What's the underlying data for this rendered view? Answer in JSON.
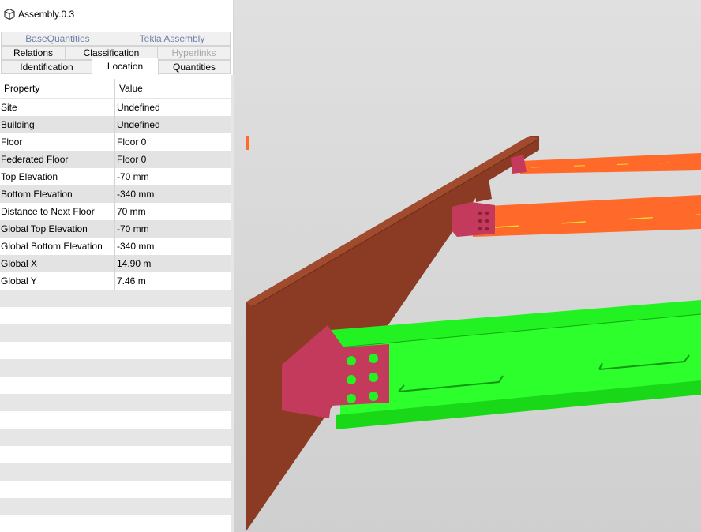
{
  "window": {
    "title": "Assembly.0.3"
  },
  "tabs": [
    {
      "label": "BaseQuantities",
      "state": "muted"
    },
    {
      "label": "Tekla Assembly",
      "state": "muted"
    },
    {
      "label": "Relations",
      "state": "normal"
    },
    {
      "label": "Classification",
      "state": "normal"
    },
    {
      "label": "Hyperlinks",
      "state": "disabled"
    },
    {
      "label": "Identification",
      "state": "normal"
    },
    {
      "label": "Location",
      "state": "active"
    },
    {
      "label": "Quantities",
      "state": "normal"
    }
  ],
  "grid": {
    "columns": [
      "Property",
      "Value"
    ],
    "rows": [
      {
        "property": "Site",
        "value": "Undefined"
      },
      {
        "property": "Building",
        "value": "Undefined"
      },
      {
        "property": "Floor",
        "value": "Floor 0"
      },
      {
        "property": "Federated Floor",
        "value": "Floor 0"
      },
      {
        "property": "Top Elevation",
        "value": "-70 mm"
      },
      {
        "property": "Bottom Elevation",
        "value": "-340 mm"
      },
      {
        "property": "Distance to Next Floor",
        "value": "70 mm"
      },
      {
        "property": "Global Top Elevation",
        "value": "-70 mm"
      },
      {
        "property": "Global Bottom Elevation",
        "value": "-340 mm"
      },
      {
        "property": "Global X",
        "value": "14.90 m"
      },
      {
        "property": "Global Y",
        "value": "7.46 m"
      }
    ]
  },
  "viewport": {
    "colors": {
      "main_beam": "#8b3a24",
      "top_beams": "#ff6a2b",
      "green_beam": "#22f222",
      "connection_plate": "#c43a5c"
    }
  }
}
